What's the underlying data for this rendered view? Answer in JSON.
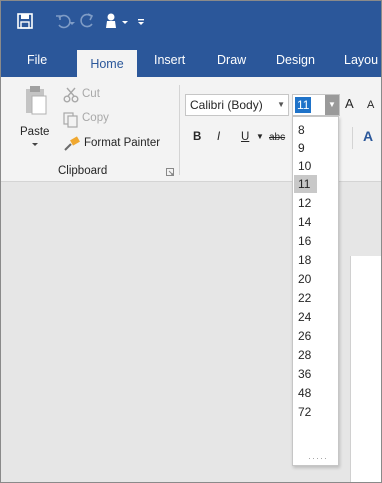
{
  "quick_access": {
    "icons": [
      "save-icon",
      "undo-icon",
      "redo-icon",
      "touch-mode-icon",
      "customize-qat-icon"
    ]
  },
  "tabs": [
    {
      "label": "File"
    },
    {
      "label": "Home"
    },
    {
      "label": "Insert"
    },
    {
      "label": "Draw"
    },
    {
      "label": "Design"
    },
    {
      "label": "Layou"
    }
  ],
  "active_tab": "Home",
  "clipboard": {
    "paste_label": "Paste",
    "cut_label": "Cut",
    "copy_label": "Copy",
    "format_painter_label": "Format Painter",
    "group_label": "Clipboard"
  },
  "font": {
    "name": "Calibri (Body)",
    "size": "11",
    "bold": "B",
    "italic": "I",
    "underline": "U",
    "strikethrough": "abc",
    "grow_font": "A",
    "shrink_font": "A",
    "text_effects": "A"
  },
  "font_size_dropdown": {
    "options": [
      "8",
      "9",
      "10",
      "11",
      "12",
      "14",
      "16",
      "18",
      "20",
      "22",
      "24",
      "26",
      "28",
      "36",
      "48",
      "72"
    ],
    "selected": "11"
  },
  "colors": {
    "title_bar": "#2b579a",
    "ribbon": "#f3f3f3",
    "selection": "#1f73c9",
    "doc_bg": "#e6e6e6"
  }
}
